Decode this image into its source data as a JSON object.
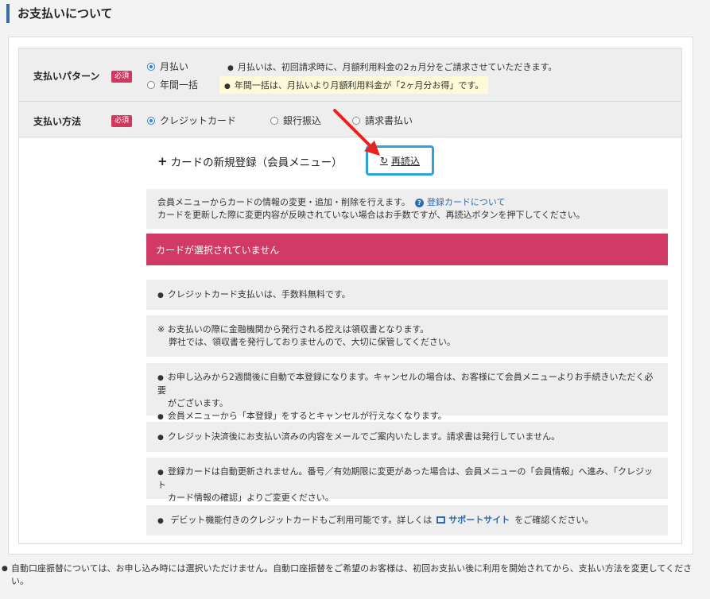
{
  "page_title": "お支払いについて",
  "payment_pattern": {
    "label": "支払いパターン",
    "badge": "必須",
    "options": [
      {
        "label": "月払い",
        "checked": true
      },
      {
        "label": "年間一括",
        "checked": false
      }
    ],
    "notes": [
      "月払いは、初回請求時に、月額利用料金の2ヵ月分をご請求させていただきます。",
      "年間一括は、月払いより月額利用料金が「2ヶ月分お得」です。"
    ]
  },
  "payment_method": {
    "label": "支払い方法",
    "badge": "必須",
    "options": [
      {
        "label": "クレジットカード",
        "checked": true
      },
      {
        "label": "銀行振込",
        "checked": false
      },
      {
        "label": "請求書払い",
        "checked": false
      }
    ]
  },
  "register_card": {
    "plus": "+",
    "label": "カードの新規登録（会員メニュー）"
  },
  "reload": {
    "icon": "↻",
    "label": "再読込"
  },
  "member_info": {
    "line1": "会員メニューからカードの情報の変更・追加・削除を行えます。",
    "help_link": "登録カードについて",
    "line2": "カードを更新した際に変更内容が反映されていない場合はお手数ですが、再読込ボタンを押下してください。"
  },
  "alert": "カードが選択されていません",
  "notices": {
    "n1": "クレジットカード支払いは、手数料無料です。",
    "n2_line1": "※ お支払いの際に金融機関から発行される控えは領収書となります。",
    "n2_line2": "弊社では、領収書を発行しておりませんので、大切に保管してください。",
    "n3_line1": "お申し込みから2週間後に自動で本登録になります。キャンセルの場合は、お客様にて会員メニューよりお手続きいただく必要",
    "n3_line1b": "がございます。",
    "n3_line2": "会員メニューから「本登録」をするとキャンセルが行えなくなります。",
    "n4": "クレジット決済後にお支払い済みの内容をメールでご案内いたします。請求書は発行していません。",
    "n5_line1": "登録カードは自動更新されません。番号／有効期限に変更があった場合は、会員メニューの「会員情報」へ進み、「クレジット",
    "n5_line2": "カード情報の確認」よりご変更ください。",
    "n6_prefix": "デビット機能付きのクレジットカードもご利用可能です。詳しくは",
    "n6_link": "サポートサイト",
    "n6_suffix": "をご確認ください。"
  },
  "footer_note": "自動口座振替については、お申し込み時には選択いただけません。自動口座振替をご希望のお客様は、初回お支払い後に利用を開始されてから、支払い方法を変更してください。",
  "colors": {
    "accent_blue": "#2a7de1",
    "badge_red": "#d2365f",
    "alert_red": "#d13a64",
    "highlight_border": "#2ea3dc",
    "arrow_red": "#e8231f"
  }
}
